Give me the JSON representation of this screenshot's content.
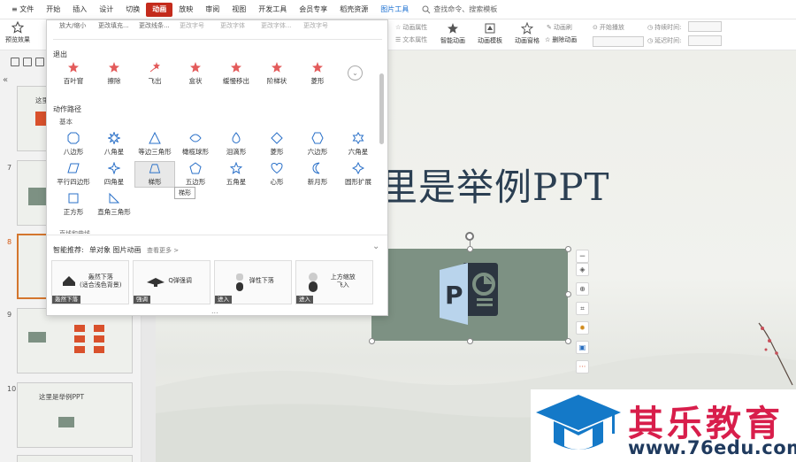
{
  "menubar": {
    "items": [
      "≡ 文件",
      "开始",
      "插入",
      "设计",
      "切换",
      "动画",
      "放映",
      "审阅",
      "视图",
      "开发工具",
      "会员专享",
      "稻壳资源",
      "图片工具"
    ],
    "active": "动画",
    "search_label": "查找命令、搜索模板"
  },
  "ribbon": {
    "preview_label": "预览效果",
    "anim_props_label": "动画属性",
    "text_props_label": "文本属性",
    "smart_anim_label": "智能动画",
    "anim_template_label": "动画模板",
    "anim_painter_label": "动画窗格",
    "anim_brush_label": "动画刷",
    "delete_anim_label": "删除动画",
    "start_play_label": "开始播放",
    "duration_label": "持续时间:",
    "delay_label": "延迟时间:"
  },
  "popup": {
    "top_row": [
      "放大/缩小",
      "更改填充...",
      "更改线条...",
      "更改字号",
      "更改字体",
      "更改字体...",
      "更改字号"
    ],
    "exit_header": "退出",
    "exit_items": [
      "百叶窗",
      "擦除",
      "飞出",
      "盒状",
      "缓慢移出",
      "阶梯状",
      "菱形"
    ],
    "path_header": "动作路径",
    "basic_header": "基本",
    "path_row1": [
      "八边形",
      "八角星",
      "等边三角形",
      "橄榄球形",
      "泪滴形",
      "菱形",
      "六边形",
      "六角星"
    ],
    "path_row2": [
      "平行四边形",
      "四角星",
      "梯形",
      "五边形",
      "五角星",
      "心形",
      "新月形",
      "圆形扩展"
    ],
    "path_row3": [
      "正方形",
      "直角三角形"
    ],
    "tooltip": "梯形",
    "partial_header": "直线和曲线",
    "smart_label": "智能推荐:",
    "smart_target": "单对象 图片动画",
    "see_more": "查看更多 >",
    "recs": [
      {
        "label": "轰然下落\n(适合浅色背景)",
        "tag": "轰然下落"
      },
      {
        "label": "Q弹强调",
        "tag": "强调"
      },
      {
        "label": "弹性下落",
        "tag": "进入"
      },
      {
        "label": "上方缩放\n飞入",
        "tag": "进入"
      }
    ],
    "more_dots": "..."
  },
  "slides": {
    "numbers": [
      "7",
      "8",
      "9",
      "10"
    ],
    "current": "8",
    "thumb_title_top": "这里",
    "thumb10_title": "这里是举例PPT"
  },
  "main_slide": {
    "title": "里是举例PPT"
  },
  "watermark": {
    "name": "其乐教育",
    "url": "www.76edu.com"
  },
  "colors": {
    "accent_red": "#c42b1c",
    "image_bg": "#7d9183",
    "title_color": "#2b3f52",
    "watermark_red": "#d81e4b",
    "watermark_blue": "#1f3a5e"
  }
}
